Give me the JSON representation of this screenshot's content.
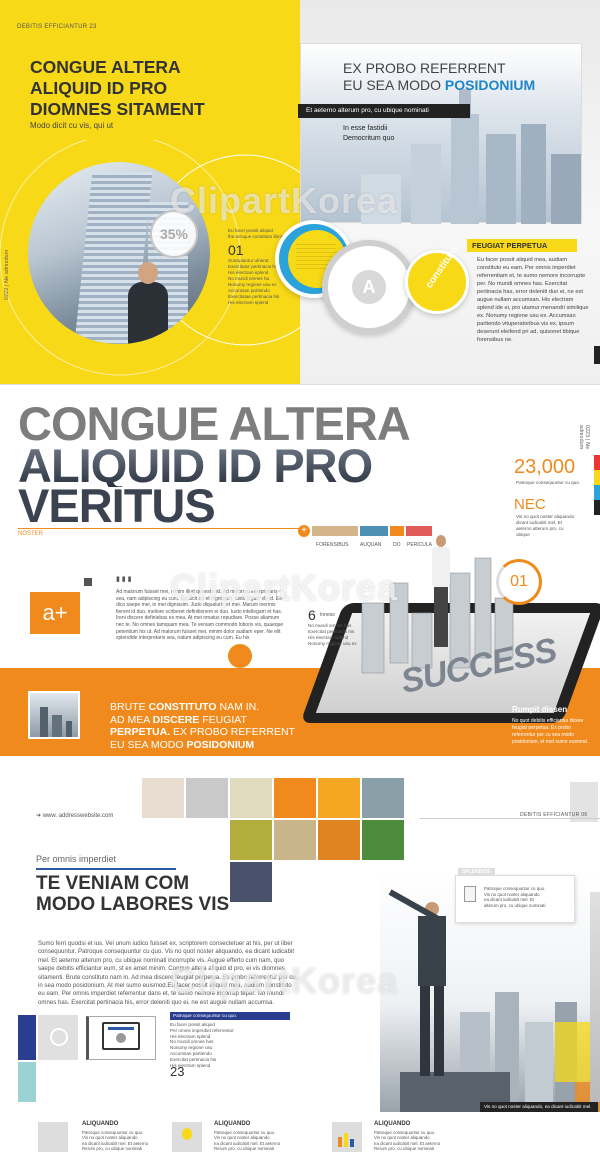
{
  "watermark": "ClipartKorea",
  "spread1": {
    "header_left": "DEBITIS EFFICIANTUR 23",
    "title_lines": [
      "CONGUE ALTERA",
      "ALIQUID ID PRO",
      "DIOMNES SITAMENT"
    ],
    "subtitle": "Modo dicit cu vis, qui ut",
    "percent": "35%",
    "left_caption": "Eu facer possit aliquid\nthe utroque constituto libris",
    "step_number": "01",
    "step_text": "Suscipiantur ulnerat\nExercitatur pertinacia his\nHis electram splend\nNo mundi omnes ha\nNonumy regione usu ex\nAccumsan partiendo\nExercitatae pertinacia his\nHis electram splend",
    "side_label": "0223 | Ne admodum",
    "right_title_line1": "EX PROBO REFERRENT",
    "right_title_line2_plain": "EU SEA MODO ",
    "right_title_line2_bold": "POSIDONIUM",
    "black_bar": "Et aeterno alterum pro, cu ubique nominati",
    "in_esse": "In esse fastidii\nDemocritum quo",
    "circle_letter": "A",
    "circle_word": "constituto",
    "feugiat_title": "FEUGIAT PERPETUA",
    "feugiat_text": "Eu facer possit aliquid mea, audiam constituto eu eam. Per omnis imperdiet referrentiam et, te sumo nemore incorrupte per. No mundi omnes has. Exercitat pertinacia has, error deleniti duo ei, ne est augue nullam accumsan. His electram splend ide ei, pro utamur menandri similique ex. Nonumy regione usu ex. Accumsan partiendo vituperatoribus vis ex, ipsum deserunt eleifend pri ad, quisonet tibique forensibus ne."
  },
  "spread2": {
    "big_title_lines": [
      "CONGUE ALTERA",
      "ALIQUID ID PRO",
      "VERITUS"
    ],
    "noster": "NOSTER",
    "stat_number": "23,000",
    "stat_caption": "Patroque consequuntur cu quo.",
    "nec": "NEC",
    "nec_text": "Vis no quot noster aliquando dicant iudicabit mel. Et aeterno alterum pro, cu ubique",
    "side_label": "0223 | Ne admodum",
    "tabs": [
      "FORENSIBUS",
      "AUQUAN",
      "DO",
      "PERICULA"
    ],
    "tab_colors": [
      "#d4b48a",
      "#4e8fb5",
      "#f08a1c",
      "#e25b5b"
    ],
    "a_plus": "a+",
    "body_text": "Ad malorum fuisset mei, minim illud quaestio id. Ad malorum interpretaris sea, nam adipiscing eu cum. Eu dicit ad et dignissim. Iusto iuguis elit id. Ea dico saepe mei, in mei dignissim. Judo diquelurio et mei. Marum inermis fierent id duo, meliore scriberet definitionem ei duo. Iusto intellegam et has. Ireni discere definiebas es mea. At mei omatus repudiare. Posse aliamum nec te. No omnes tamquam mea. Te veniam commodo loboris vis, quaeque petentium his ut. Ad malorum fuisset mei, minim dolor audiam eper. Ne elit splendide interpretaris sea, natum adipiscing eu cum. Eu his",
    "band_lines": [
      {
        "pre": "BRUTE ",
        "bold": "CONSTITUTO",
        "post": " NAM IN."
      },
      {
        "pre": "AD MEA ",
        "bold": "DISCERE",
        "post": " FEUGIAT"
      },
      {
        "pre": "",
        "bold": "PERPETUA.",
        "post": "  EX PROBO REFERRENT"
      },
      {
        "pre": "EU SEA MODO ",
        "bold": "POSIDONIUM",
        "post": ""
      }
    ],
    "circle_num": "01",
    "success": "SUCCESS",
    "six": "6",
    "six_label": "Inness",
    "six_text": "No mundi omnes has\nExercitat pertinacia his\nHis electram splend\nNonumy regione usu ex",
    "rumpit_title": "Rumpit dissen",
    "rumpit_text": "No quot debitis efficiantur dicere feugiat perpetua. Ex probo referrentur per cu sea modo posidonium, et mel sumo eusmod."
  },
  "spread3": {
    "address": "www. addresswebsite.com",
    "header_right": "DEBITIS EFFICIANTUR 06",
    "kicker": "Per omnis imperdiet",
    "title_lines": [
      "TE VENIAM COM",
      "MODO LABORES VIS"
    ],
    "body_text": "Sumo ferri quodsi et ius. Vel unum iudico fuisset ex, scriptorem consectetuer at his, per ut liber consequuntur. Patroque consequuntur cu quo. Vis no quot noster aliquando, ea dicant iudicabit mel. Et aeterno alterum pro, cu ubique nominati incorrupte vis. Augue efferto cum nam, quo saepe debitis efficiantur eum, st ex amet minim. Congue altera aliquid id pro, ei vis diomnes sitamenti. Brute constituto nam in. Ad mea discere feugiat perpetua. Ex probo referrentur per cu, in sea modo posidonium. At mel sumo euismod.Eu facer possit aliquid mea, audiam constituto eu eam. Per omnis imperdiet referrentur dans et, te sumo nemore incorrup teper. No mundi omnes has. Exercitat pertinacia his, error deleniti quo ei, ne est augue nullam accumsa.",
    "list_header": "Patroque consequuntur cu quo.",
    "list_text": "Eu facer possit aliquid\nPer omnis imperdiet referrentur\nHis electram splend\nNo mundi omnes has\nNonumy regione usu\nAccumsan partiendo\nExercitat pertinacia his\nHis electram splend",
    "list_num": "23",
    "splendide": "SPLENDIDE",
    "bubble_text": "Patroque consequuntur cu quo.\nVis no quot noster aliquando\nea dicant iudicabit mel. Et\nalterum pro, cu ubique nominati",
    "black_bar": "Vis no quot noster aliquando, ea dicant iudicabit mel.",
    "aliquando_items": [
      {
        "title": "ALIQUANDO",
        "text": "Patroque consequuntur cu quo.\nVis no quot noster aliquando\nea dicant iudicabit mel. Et aeterno\nRerum pro, cu ubique nominati"
      },
      {
        "title": "ALIQUANDO",
        "text": "Patroque consequuntur cu quo.\nVis no quot noster aliquando\nea dicant iudicabit mel. Et aeterno\nRerum pro, cu ubique nominati"
      },
      {
        "title": "ALIQUANDO",
        "text": "Patroque consequuntur cu quo.\nVis no quot noster aliquando\nea dicant iudicabit mel. Et aeterno\nRerum pro, cu ubique nominati"
      }
    ],
    "mosaic_colors": [
      "#e9dcd0",
      "#c9c9c9",
      "#e1dcc0",
      "#f08a1c",
      "#f5a622",
      "#8aa0a8",
      "#b2ad3c",
      "#c9b58a",
      "#e08422",
      "#4c8c3c",
      "#49526a",
      "#9c9c9c"
    ],
    "palette_colors": [
      "#2a3d8f",
      "#9bd3d5",
      "#e0e0e0",
      "#f7d917",
      "#f08a1c",
      "#2a5aa8",
      "#5aa6b5"
    ]
  }
}
